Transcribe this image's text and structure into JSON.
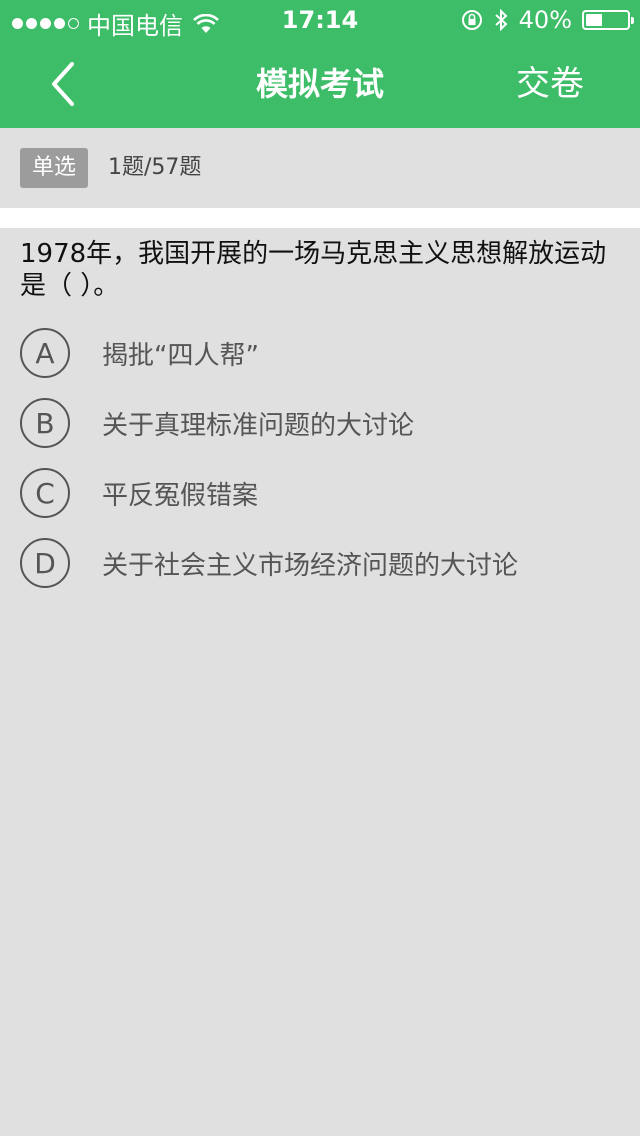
{
  "status_bar": {
    "carrier": "中国电信",
    "time": "17:14",
    "battery_percent": "40%",
    "battery_level": 0.4,
    "signal_dots_filled": 4,
    "signal_dots_total": 5
  },
  "nav": {
    "title": "模拟考试",
    "submit_label": "交卷",
    "back_icon": "chevron-left-icon"
  },
  "info": {
    "type_badge": "单选",
    "progress": "1题/57题"
  },
  "question": {
    "text": "1978年，我国开展的一场马克思主义思想解放运动是（  ）。",
    "options": [
      {
        "letter": "A",
        "text": "揭批“四人帮”"
      },
      {
        "letter": "B",
        "text": "关于真理标准问题的大讨论"
      },
      {
        "letter": "C",
        "text": "平反冤假错案"
      },
      {
        "letter": "D",
        "text": "关于社会主义市场经济问题的大讨论"
      }
    ]
  },
  "colors": {
    "header": "#3dbd68",
    "background": "#e0e0e0",
    "badge": "#9c9c9c"
  }
}
